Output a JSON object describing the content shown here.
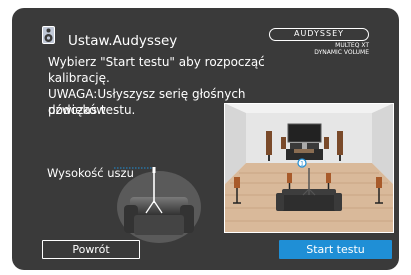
{
  "header": {
    "title": "Ustaw.Audyssey",
    "icon": "speaker-icon"
  },
  "logo": {
    "brand": "AUDYSSEY",
    "line1": "MULTEQ XT",
    "line2": "DYNAMIC VOLUME"
  },
  "message": {
    "line1": "Wybierz \"Start testu\" aby rozpocząć",
    "line2": "kalibrację.",
    "line3": "UWAGA:Usłyszysz serię głośnych dźwięków",
    "line4": "podczas testu."
  },
  "diagram": {
    "ear_height_label": "Wysokość uszu",
    "mic_position_marker": "1"
  },
  "buttons": {
    "back_label": "Powrót",
    "start_label": "Start testu"
  },
  "colors": {
    "background": "#3a3a3a",
    "accent": "#1f8fd6"
  }
}
